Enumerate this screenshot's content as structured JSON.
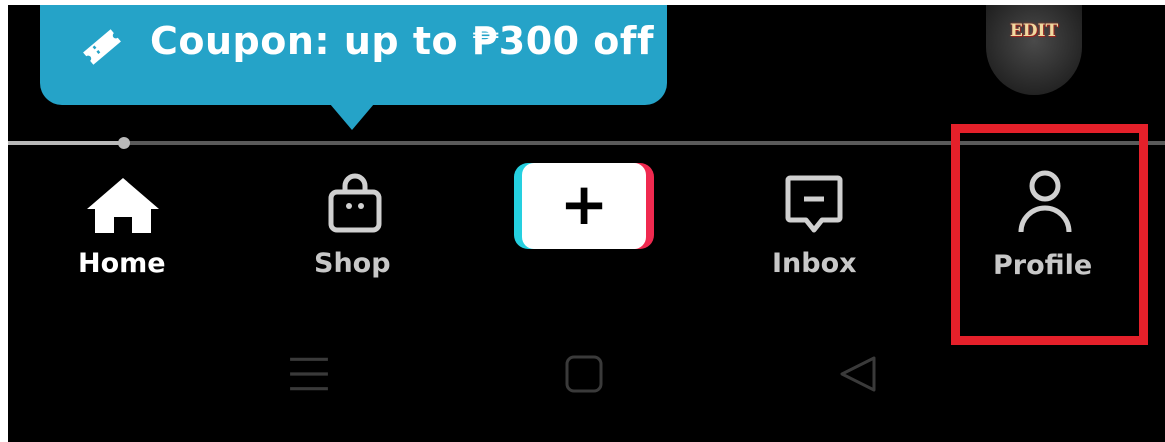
{
  "coupon": {
    "text": "Coupon: up to ₱300 off",
    "icon": "ticket-icon",
    "color": "#25a3c8"
  },
  "avatar": {
    "text": "EDIT",
    "icon": "profile-avatar"
  },
  "progress": {
    "value": 0.1
  },
  "nav": {
    "items": [
      {
        "label": "Home",
        "icon": "home-icon",
        "active": true,
        "color": "#ffffff"
      },
      {
        "label": "Shop",
        "icon": "shopping-bag-icon",
        "active": false,
        "color": "#c8c8c8"
      },
      {
        "label": "",
        "icon": "plus-icon",
        "active": false
      },
      {
        "label": "Inbox",
        "icon": "message-icon",
        "active": false,
        "color": "#c8c8c8"
      },
      {
        "label": "Profile",
        "icon": "person-icon",
        "active": false,
        "color": "#c8c8c8"
      }
    ]
  },
  "highlight": {
    "target": "Profile",
    "color": "#e5202a"
  },
  "system_nav": {
    "items": [
      "menu-icon",
      "home-square-icon",
      "back-triangle-icon"
    ]
  }
}
